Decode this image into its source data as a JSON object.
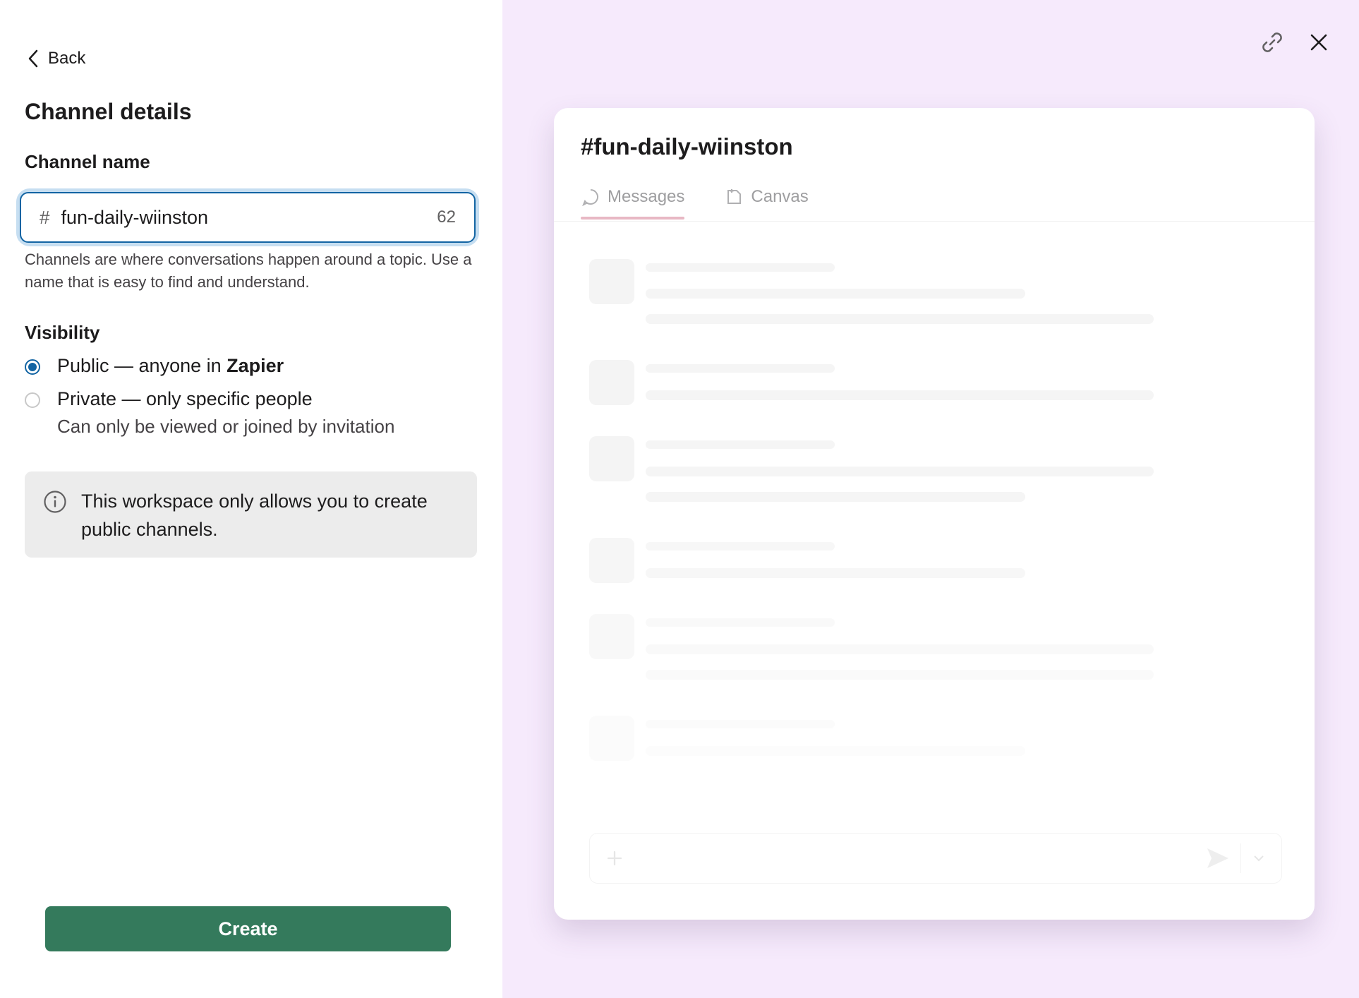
{
  "nav": {
    "back_label": "Back"
  },
  "form": {
    "title": "Channel details",
    "channel_name_label": "Channel name",
    "channel_prefix": "#",
    "channel_name_value": "fun-daily-wiinston",
    "char_count": "62",
    "hint": "Channels are where conversations happen around a topic. Use a name that is easy to find and understand.",
    "visibility_label": "Visibility",
    "public_option": {
      "prefix": "Public — anyone in ",
      "org": "Zapier",
      "selected": true
    },
    "private_option": {
      "label": "Private — only specific people",
      "sub": "Can only be viewed or joined by invitation",
      "selected": false
    },
    "notice": "This workspace only allows you to create public channels.",
    "create_label": "Create"
  },
  "header_icons": {
    "link": "link-icon",
    "close": "close-icon"
  },
  "preview": {
    "title": "#fun-daily-wiinston",
    "tabs": [
      {
        "label": "Messages",
        "icon": "message-icon",
        "active": true
      },
      {
        "label": "Canvas",
        "icon": "canvas-icon",
        "active": false
      }
    ]
  },
  "colors": {
    "accent_blue": "#1264a3",
    "create_green": "#347a5c",
    "right_bg": "#f6eafc"
  }
}
